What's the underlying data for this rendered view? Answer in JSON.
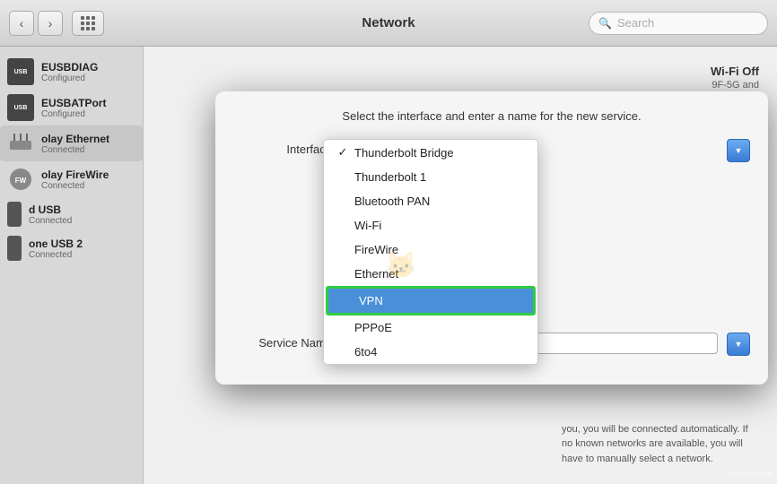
{
  "titlebar": {
    "title": "Network",
    "search_placeholder": "Search",
    "back_label": "‹",
    "forward_label": "›"
  },
  "dialog": {
    "instruction": "Select the interface and enter a name for the new service.",
    "interface_label": "Interface",
    "service_name_label": "Service Name",
    "dropdown_items": [
      {
        "id": "thunderbolt-bridge",
        "label": "Thunderbolt Bridge",
        "checked": true
      },
      {
        "id": "thunderbolt-1",
        "label": "Thunderbolt 1",
        "checked": false
      },
      {
        "id": "bluetooth-pan",
        "label": "Bluetooth PAN",
        "checked": false
      },
      {
        "id": "wifi",
        "label": "Wi-Fi",
        "checked": false
      },
      {
        "id": "firewire",
        "label": "FireWire",
        "checked": false
      },
      {
        "id": "ethernet",
        "label": "Ethernet",
        "checked": false
      },
      {
        "id": "vpn",
        "label": "VPN",
        "checked": false,
        "highlighted": true
      },
      {
        "id": "pppoe",
        "label": "PPPoE",
        "checked": false
      },
      {
        "id": "6to4",
        "label": "6to4",
        "checked": false
      }
    ]
  },
  "sidebar": {
    "items": [
      {
        "name": "EUSBDIAG",
        "status": "Configured"
      },
      {
        "name": "EUSBATPort",
        "status": "Configured"
      },
      {
        "name": "olay Ethernet",
        "status": "Connected"
      },
      {
        "name": "olay FireWire",
        "status": "Connected"
      },
      {
        "name": "d USB",
        "status": "Connected"
      },
      {
        "name": "one USB 2",
        "status": "Connected"
      }
    ]
  },
  "wifi_panel": {
    "status": "Wi-Fi Off",
    "network_label": "9F-5G and",
    "description": "you, you will be connected automatically. If no known networks are available, you will have to manually select a network."
  },
  "watermark": "wsxdn.com"
}
